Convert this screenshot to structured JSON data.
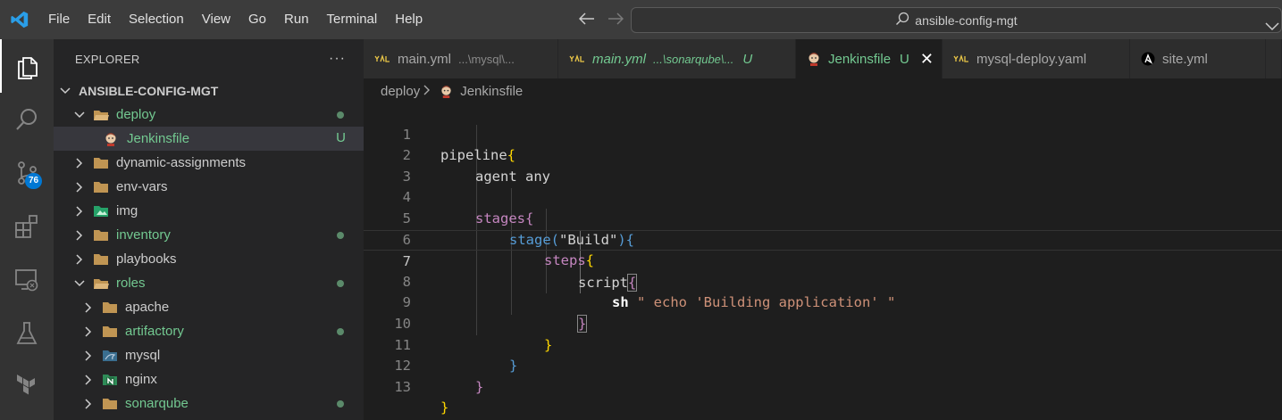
{
  "menu": [
    "File",
    "Edit",
    "Selection",
    "View",
    "Go",
    "Run",
    "Terminal",
    "Help"
  ],
  "search": {
    "label": "ansible-config-mgt"
  },
  "activity": {
    "scm_badge": "76"
  },
  "explorer": {
    "title": "EXPLORER",
    "more": "···",
    "root": "ANSIBLE-CONFIG-MGT",
    "items": [
      {
        "label": "deploy",
        "status": "dot"
      },
      {
        "label": "Jenkinsfile",
        "status": "U"
      },
      {
        "label": "dynamic-assignments"
      },
      {
        "label": "env-vars"
      },
      {
        "label": "img"
      },
      {
        "label": "inventory",
        "status": "dot"
      },
      {
        "label": "playbooks"
      },
      {
        "label": "roles",
        "status": "dot"
      },
      {
        "label": "apache"
      },
      {
        "label": "artifactory",
        "status": "dot"
      },
      {
        "label": "mysql"
      },
      {
        "label": "nginx"
      },
      {
        "label": "sonarqube",
        "status": "dot"
      }
    ]
  },
  "tabs": [
    {
      "name": "main.yml",
      "desc": "...\\mysql\\..."
    },
    {
      "name": "main.yml",
      "desc": "...\\sonarqube\\...",
      "status": "U"
    },
    {
      "name": "Jenkinsfile",
      "status": "U",
      "close": "✕"
    },
    {
      "name": "mysql-deploy.yaml"
    },
    {
      "name": "site.yml"
    }
  ],
  "breadcrumb": {
    "folder": "deploy",
    "file": "Jenkinsfile"
  },
  "editor": {
    "line_numbers": [
      "1",
      "2",
      "3",
      "4",
      "5",
      "6",
      "7",
      "8",
      "9",
      "10",
      "11",
      "12",
      "13"
    ],
    "lines": {
      "l1a": "pipeline",
      "l1b": "{",
      "l2": "agent any",
      "l4a": "stages",
      "l4b": "{",
      "l5a": "stage(",
      "l5b": "\"Build\"",
      "l5c": "){",
      "l6a": "steps",
      "l6b": "{",
      "l7a": "script",
      "l7b": "{",
      "l8a": "sh",
      "l8b": " \" echo 'Building application' \"",
      "l9": "}",
      "l10": "}",
      "l11": "}",
      "l12": "}",
      "l13": "}"
    }
  },
  "colors": {
    "accent_green": "#73c991",
    "keyword_purple": "#c586c0",
    "bracket_gold": "#ffd700",
    "string": "#ce9178",
    "badge_blue": "#0078d4"
  }
}
